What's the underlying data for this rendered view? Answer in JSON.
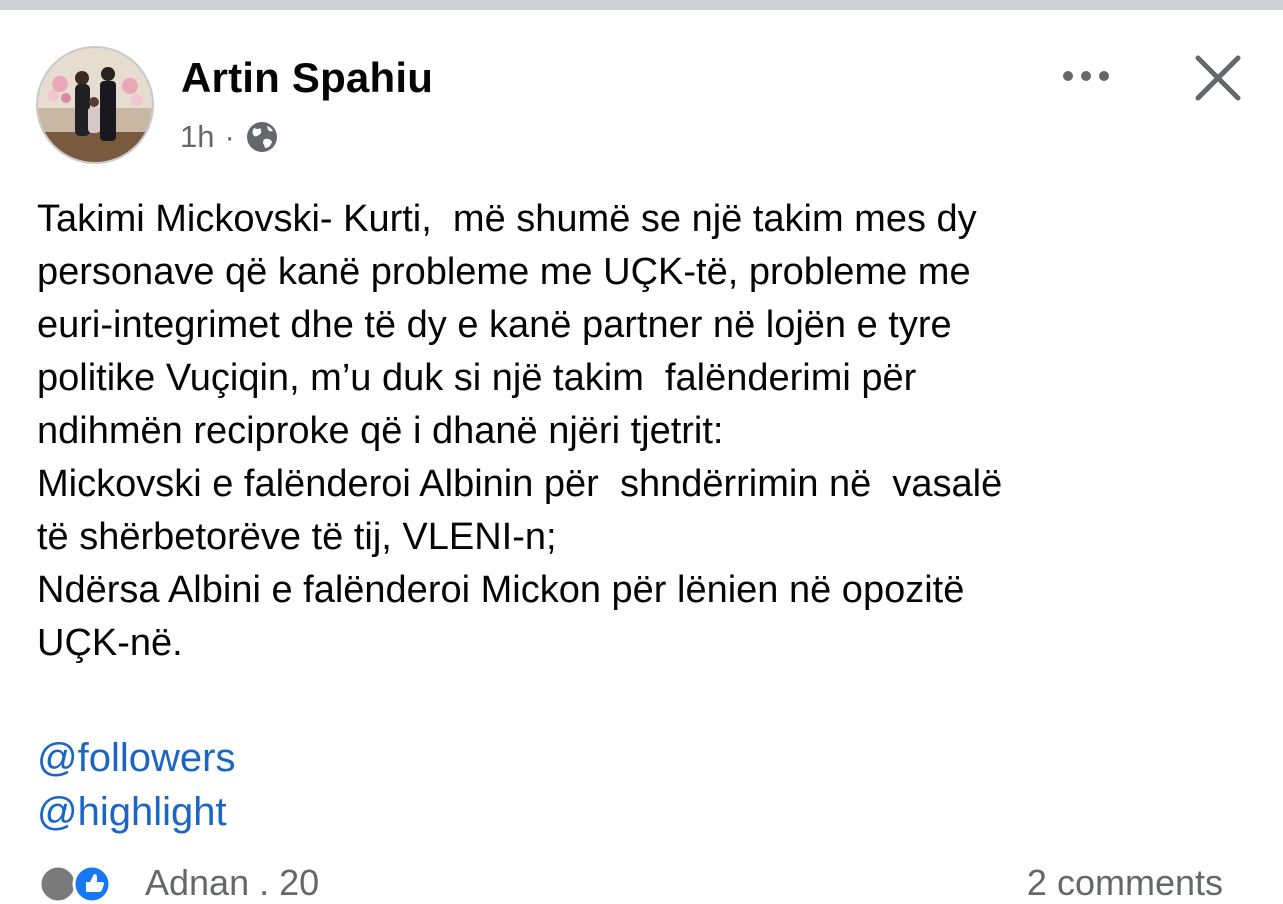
{
  "post": {
    "author": "Artin Spahiu",
    "time": "1h",
    "separator": "·",
    "audience_icon": "globe-icon",
    "text_lines": [
      "Takimi Mickovski- Kurti,  më shumë se një takim mes dy",
      "personave që kanë probleme me UÇK-të, probleme me",
      "euri-integrimet dhe të dy e kanë partner në lojën e tyre",
      "politike Vuçiqin, m’u duk si një takim  falënderimi për",
      "ndihmën reciproke që i dhanë njëri tjetrit:",
      "Mickovski e falënderoi Albinin për  shndërrimin në  vasalë",
      "të shërbetorëve të tij, VLENI-n;",
      "Ndërsa Albini e falënderoi Mickon për lënien në opozitë",
      "UÇK-në."
    ],
    "tags": [
      "@followers",
      "@highlight"
    ]
  },
  "reactions": {
    "summary": "Adnan . 20",
    "comments": "2 comments"
  },
  "colors": {
    "link": "#1a66c6",
    "secondary_text": "#65676b",
    "primary_text": "#050505"
  }
}
